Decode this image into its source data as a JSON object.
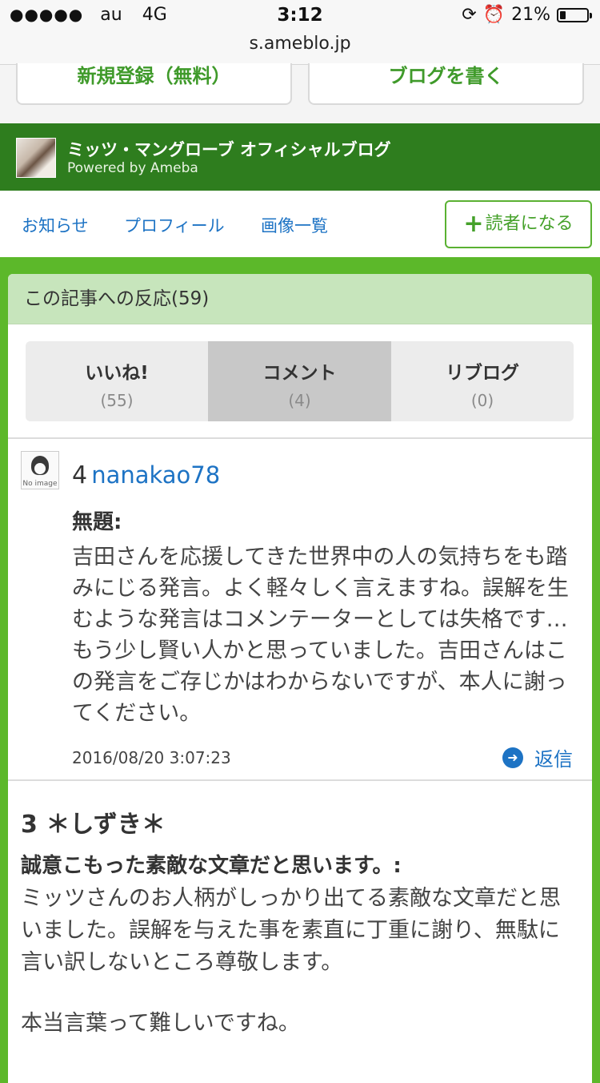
{
  "status_bar": {
    "signal": "●●●●●",
    "carrier": "au",
    "network": "4G",
    "time": "3:12",
    "battery": "21%",
    "battery_level": 0.21,
    "url": "s.ameblo.jp"
  },
  "top_buttons": {
    "register": "新規登録（無料）",
    "write_blog": "ブログを書く"
  },
  "blog": {
    "title": "ミッツ・マングローブ オフィシャルブログ",
    "subtitle": "Powered by Ameba"
  },
  "nav": {
    "news": "お知らせ",
    "profile": "プロフィール",
    "images": "画像一覧",
    "follow_plus": "+",
    "follow": "読者になる"
  },
  "reactions": {
    "header": "この記事への反応(59)",
    "tabs": [
      {
        "label": "いいね!",
        "count": "(55)"
      },
      {
        "label": "コメント",
        "count": "(4)"
      },
      {
        "label": "リブログ",
        "count": "(0)"
      }
    ],
    "selected_tab": "コメント"
  },
  "comments": [
    {
      "number": "4",
      "user": "nanakao78",
      "avatar_text": "No image",
      "title": "無題:",
      "body": "吉田さんを応援してきた世界中の人の気持ちをも踏みにじる発言。よく軽々しく言えますね。誤解を生むような発言はコメンテーターとしては失格です…もう少し賢い人かと思っていました。吉田さんはこの発言をご存じかはわからないですが、本人に謝ってください。",
      "date": "2016/08/20 3:07:23",
      "reply": "返信"
    },
    {
      "header": "3 ＊しずき＊",
      "title": "誠意こもった素敵な文章だと思います。:",
      "body": "ミッツさんのお人柄がしっかり出てる素敵な文章だと思いました。誤解を与えた事を素直に丁重に謝り、無駄に言い訳しないところ尊敬します。",
      "body2": "本当言葉って難しいですね。"
    }
  ]
}
